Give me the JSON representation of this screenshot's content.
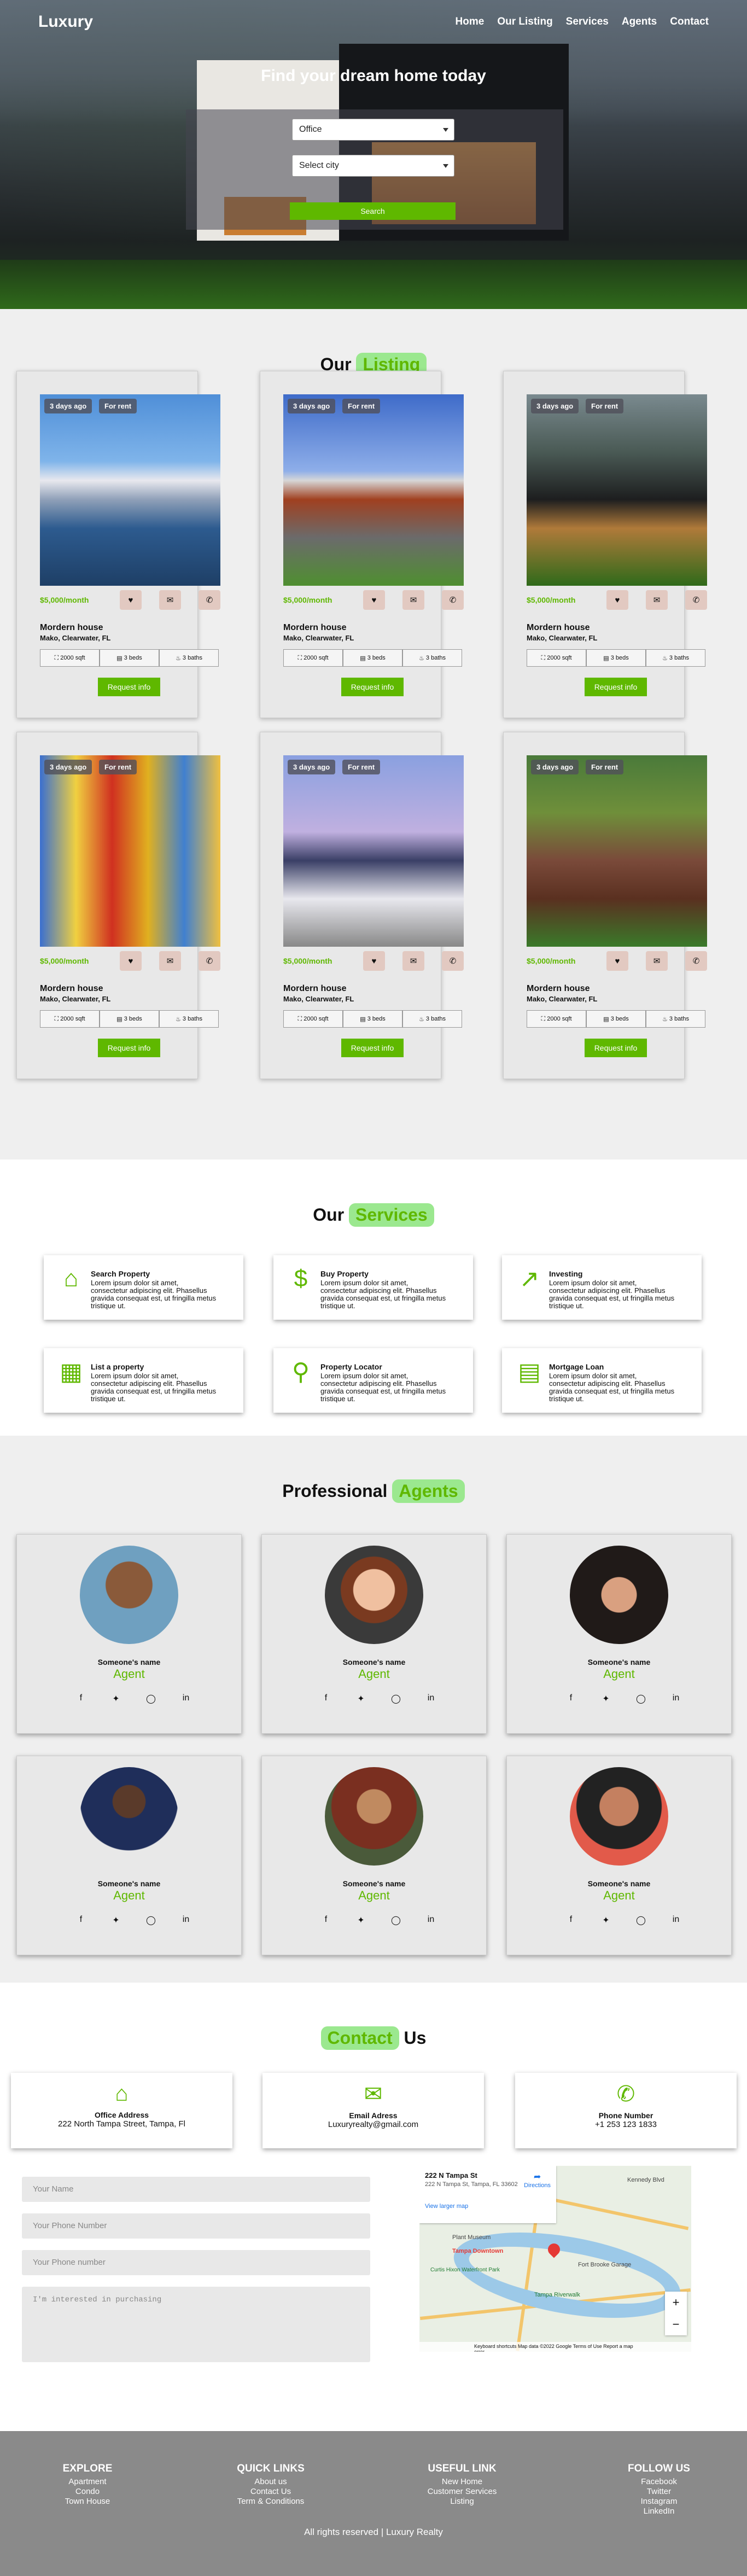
{
  "header": {
    "logo": "Luxury",
    "nav": [
      "Home",
      "Our Listing",
      "Services",
      "Agents",
      "Contact"
    ],
    "hero_title": "Find your dream home today",
    "type_select": "Office",
    "city_select": "Select city",
    "search_label": "Search"
  },
  "listing": {
    "title_plain": "Our",
    "title_highlight": "Listing",
    "cards": [
      {
        "age": "3 days ago",
        "status": "For rent",
        "price": "$5,000/month",
        "name": "Mordern house",
        "address": "Mako, Clearwater, FL",
        "sqft": "2000 sqft",
        "beds": "3 beds",
        "baths": "3 baths",
        "cta": "Request info"
      },
      {
        "age": "3 days ago",
        "status": "For rent",
        "price": "$5,000/month",
        "name": "Mordern house",
        "address": "Mako, Clearwater, FL",
        "sqft": "2000 sqft",
        "beds": "3 beds",
        "baths": "3 baths",
        "cta": "Request info"
      },
      {
        "age": "3 days ago",
        "status": "For rent",
        "price": "$5,000/month",
        "name": "Mordern house",
        "address": "Mako, Clearwater, FL",
        "sqft": "2000 sqft",
        "beds": "3 beds",
        "baths": "3 baths",
        "cta": "Request info"
      },
      {
        "age": "3 days ago",
        "status": "For rent",
        "price": "$5,000/month",
        "name": "Mordern house",
        "address": "Mako, Clearwater, FL",
        "sqft": "2000 sqft",
        "beds": "3 beds",
        "baths": "3 baths",
        "cta": "Request info"
      },
      {
        "age": "3 days ago",
        "status": "For rent",
        "price": "$5,000/month",
        "name": "Mordern house",
        "address": "Mako, Clearwater, FL",
        "sqft": "2000 sqft",
        "beds": "3 beds",
        "baths": "3 baths",
        "cta": "Request info"
      },
      {
        "age": "3 days ago",
        "status": "For rent",
        "price": "$5,000/month",
        "name": "Mordern house",
        "address": "Mako, Clearwater, FL",
        "sqft": "2000 sqft",
        "beds": "3 beds",
        "baths": "3 baths",
        "cta": "Request info"
      }
    ]
  },
  "services": {
    "title_plain": "Our",
    "title_highlight": "Services",
    "items": [
      {
        "icon": "house-icon",
        "title": "Search Property",
        "desc": "Lorem ipsum dolor sit amet, consectetur adipiscing elit. Phasellus gravida consequat est, ut fringilla metus tristique ut."
      },
      {
        "icon": "dollar-icon",
        "title": "Buy Property",
        "desc": "Lorem ipsum dolor sit amet, consectetur adipiscing elit. Phasellus gravida consequat est, ut fringilla metus tristique ut."
      },
      {
        "icon": "chart-icon",
        "title": "Investing",
        "desc": "Lorem ipsum dolor sit amet, consectetur adipiscing elit. Phasellus gravida consequat est, ut fringilla metus tristique ut."
      },
      {
        "icon": "building-icon",
        "title": "List a property",
        "desc": "Lorem ipsum dolor sit amet, consectetur adipiscing elit. Phasellus gravida consequat est, ut fringilla metus tristique ut."
      },
      {
        "icon": "search-icon",
        "title": "Property Locator",
        "desc": "Lorem ipsum dolor sit amet, consectetur adipiscing elit. Phasellus gravida consequat est, ut fringilla metus tristique ut."
      },
      {
        "icon": "money-icon",
        "title": "Mortgage Loan",
        "desc": "Lorem ipsum dolor sit amet, consectetur adipiscing elit. Phasellus gravida consequat est, ut fringilla metus tristique ut."
      }
    ]
  },
  "agents": {
    "title_plain": "Professional",
    "title_highlight": "Agents",
    "items": [
      {
        "name": "Someone's name",
        "role": "Agent"
      },
      {
        "name": "Someone's name",
        "role": "Agent"
      },
      {
        "name": "Someone's name",
        "role": "Agent"
      },
      {
        "name": "Someone's name",
        "role": "Agent"
      },
      {
        "name": "Someone's name",
        "role": "Agent"
      },
      {
        "name": "Someone's name",
        "role": "Agent"
      }
    ]
  },
  "contact": {
    "title_highlight": "Contact",
    "title_plain": "Us",
    "boxes": [
      {
        "title": "Office Address",
        "value": "222 North Tampa Street, Tampa, Fl"
      },
      {
        "title": "Email Adress",
        "value": "Luxuryrealty@gmail.com"
      },
      {
        "title": "Phone Number",
        "value": "+1 253 123 1833"
      }
    ],
    "form": {
      "name_placeholder": "Your Name",
      "phone_placeholder": "Your Phone Number",
      "phone2_placeholder": "Your Phone number",
      "message_placeholder": "I'm interested in purchasing"
    },
    "map": {
      "place": "222 N Tampa St",
      "address": "222 N Tampa St, Tampa, FL 33602",
      "directions": "Directions",
      "larger": "View larger map",
      "labels": [
        "Tampa Downtown",
        "Curtis Hixon Waterfront Park",
        "Tampa Riverwalk",
        "Kennedy Blvd",
        "Fort Brooke Garage",
        "Plant Museum"
      ],
      "footer": "Keyboard shortcuts   Map data ©2022 Google   Terms of Use   Report a map error"
    }
  },
  "footer": {
    "columns": [
      {
        "title": "EXPLORE",
        "links": [
          "Apartment",
          "Condo",
          "Town House"
        ]
      },
      {
        "title": "QUICK LINKS",
        "links": [
          "About us",
          "Contact Us",
          "Term & Conditions"
        ]
      },
      {
        "title": "USEFUL LINK",
        "links": [
          "New Home",
          "Customer Services",
          "Listing"
        ]
      },
      {
        "title": "FOLLOW US",
        "links": [
          "Facebook",
          "Twitter",
          "Instagram",
          "LinkedIn"
        ]
      }
    ],
    "copyright": "All rights reserved | Luxury Realty"
  }
}
